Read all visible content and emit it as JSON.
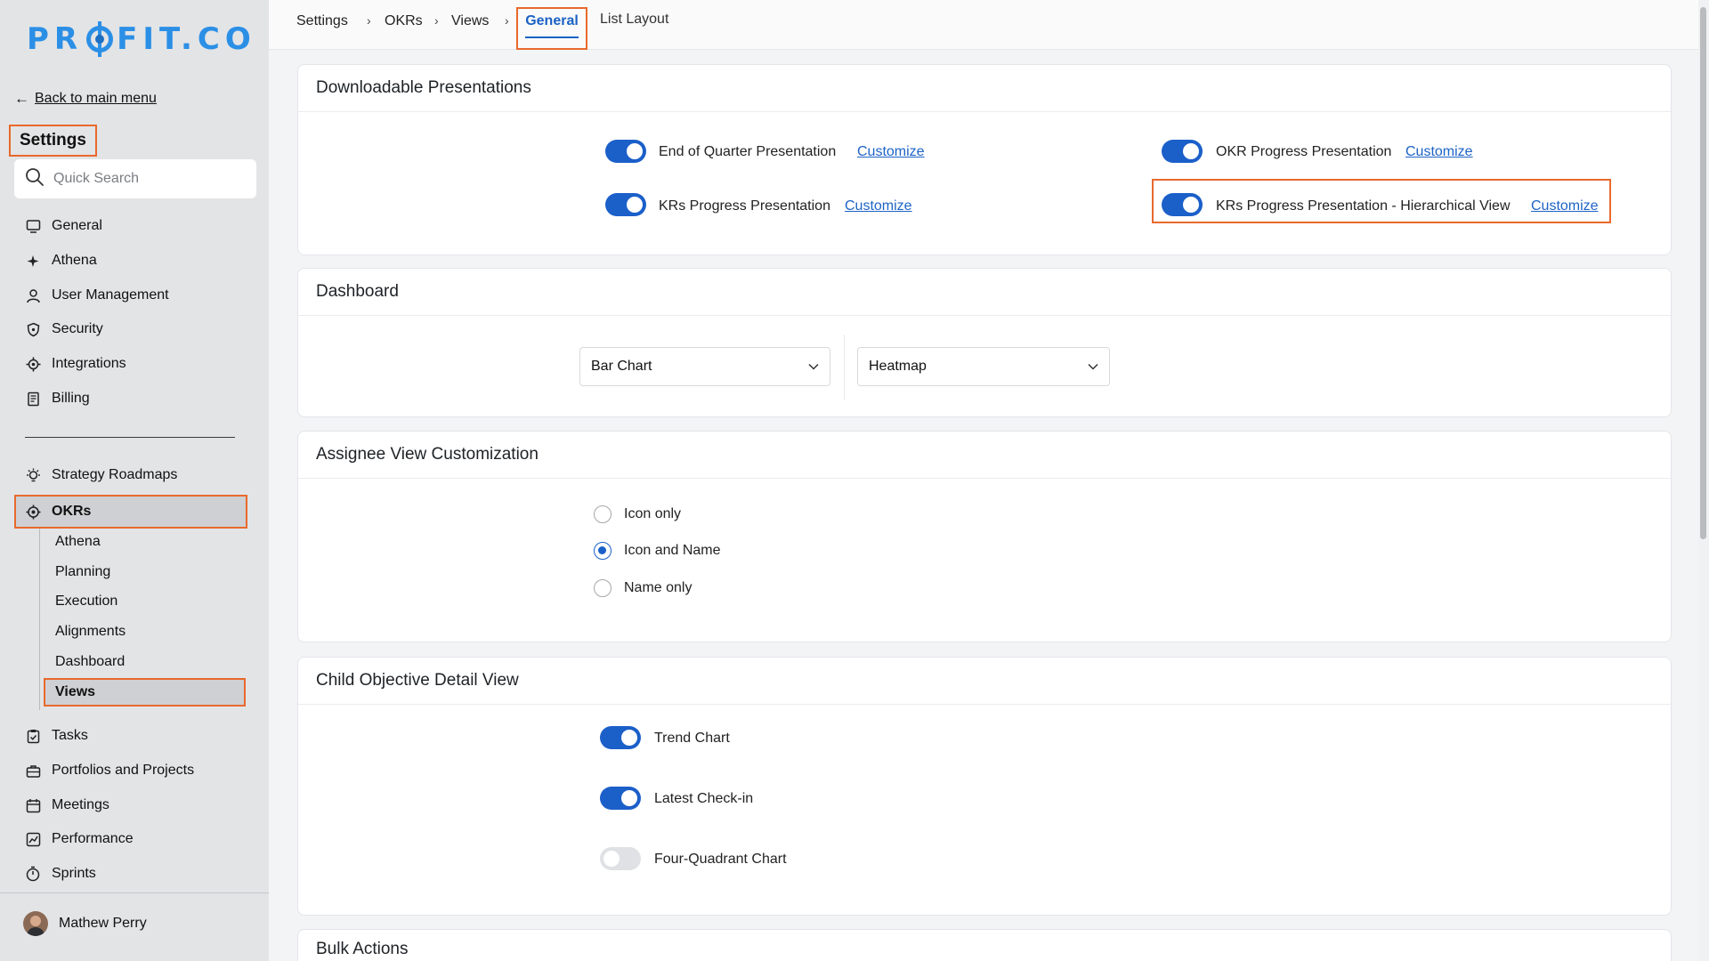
{
  "brand": {
    "logo_prefix": "PR",
    "logo_suffix": "FIT.CO"
  },
  "sidebar": {
    "back_label": "Back to main menu",
    "title": "Settings",
    "search_placeholder": "Quick Search",
    "items": [
      {
        "label": "General",
        "icon": "monitor-icon"
      },
      {
        "label": "Athena",
        "icon": "sparkle-icon"
      },
      {
        "label": "User Management",
        "icon": "user-icon"
      },
      {
        "label": "Security",
        "icon": "shield-icon"
      },
      {
        "label": "Integrations",
        "icon": "gear-icon"
      },
      {
        "label": "Billing",
        "icon": "receipt-icon"
      }
    ],
    "modules": [
      {
        "label": "Strategy Roadmaps",
        "icon": "bulb-icon"
      },
      {
        "label": "OKRs",
        "icon": "target-icon"
      }
    ],
    "okr_subitems": [
      "Athena",
      "Planning",
      "Execution",
      "Alignments",
      "Dashboard",
      "Views"
    ],
    "more_modules": [
      {
        "label": "Tasks",
        "icon": "clipboard-check-icon"
      },
      {
        "label": "Portfolios and Projects",
        "icon": "briefcase-icon"
      },
      {
        "label": "Meetings",
        "icon": "calendar-icon"
      },
      {
        "label": "Performance",
        "icon": "chart-icon"
      },
      {
        "label": "Sprints",
        "icon": "stopwatch-icon"
      }
    ],
    "user_name": "Mathew Perry"
  },
  "breadcrumb": {
    "items": [
      "Settings",
      "OKRs",
      "Views"
    ],
    "separator": "›",
    "active_tab": "General",
    "other_tab": "List Layout"
  },
  "downloadable": {
    "title": "Downloadable Presentations",
    "customize_label": "Customize",
    "items": [
      {
        "label": "End of Quarter Presentation",
        "enabled": true
      },
      {
        "label": "OKR Progress Presentation",
        "enabled": true
      },
      {
        "label": "KRs Progress Presentation",
        "enabled": true
      },
      {
        "label": "KRs Progress Presentation - Hierarchical View",
        "enabled": true
      }
    ]
  },
  "dashboard": {
    "title": "Dashboard",
    "select_1": "Bar Chart",
    "select_2": "Heatmap"
  },
  "assignee": {
    "title": "Assignee View Customization",
    "options": [
      "Icon only",
      "Icon and Name",
      "Name only"
    ],
    "selected": "Icon and Name"
  },
  "child_objective": {
    "title": "Child Objective Detail View",
    "items": [
      {
        "label": "Trend Chart",
        "enabled": true
      },
      {
        "label": "Latest Check-in",
        "enabled": true
      },
      {
        "label": "Four-Quadrant Chart",
        "enabled": false
      }
    ]
  },
  "bulk_actions": {
    "title": "Bulk Actions"
  },
  "colors": {
    "accent": "#1b5fc9",
    "highlight": "#e8692c",
    "brand": "#2b8fe6"
  }
}
